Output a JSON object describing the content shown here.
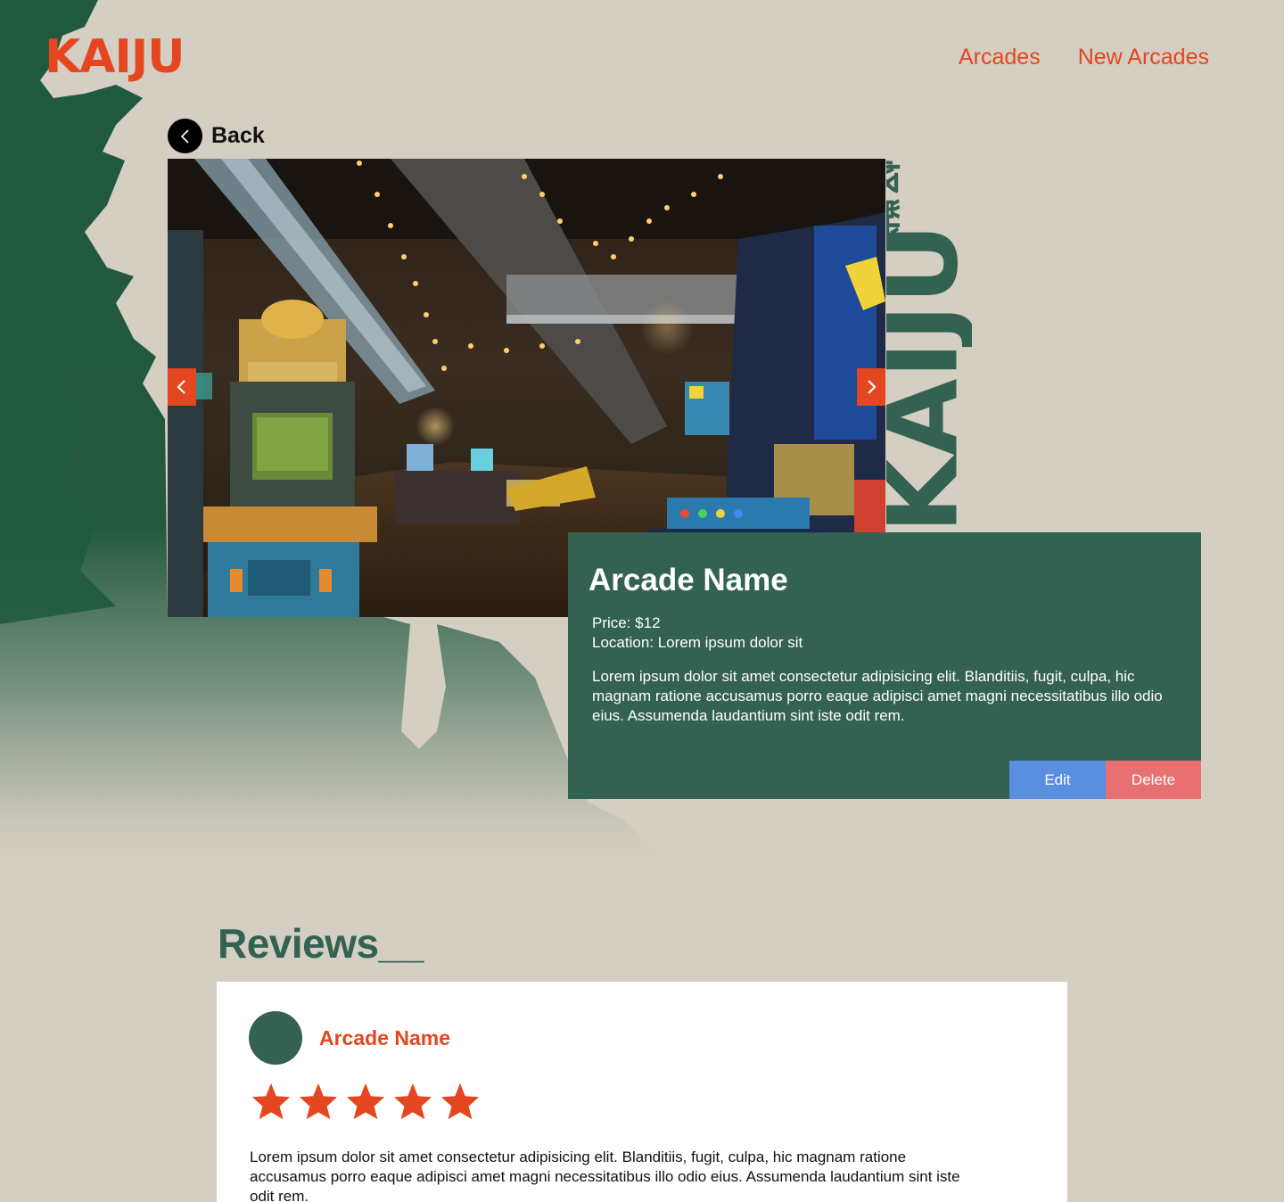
{
  "brand": {
    "logo": "KAIJU",
    "vertical_wordmark": "KAIJU",
    "vertical_kanji": "怪獣",
    "accent": "#e4461f",
    "green": "#336152",
    "background": "#d5cfc3"
  },
  "nav": {
    "links": [
      "Arcades",
      "New Arcades"
    ]
  },
  "back": {
    "label": "Back",
    "icon": "chevron-left-icon"
  },
  "carousel": {
    "prev_icon": "chevron-left-icon",
    "next_icon": "chevron-right-icon",
    "image": "arcade-interior-photo"
  },
  "arcade": {
    "name": "Arcade Name",
    "price": "Price: $12",
    "location": "Location: Lorem ipsum dolor sit",
    "description": "Lorem ipsum dolor sit amet consectetur adipisicing elit. Blanditiis, fugit, culpa, hic magnam ratione accusamus porro eaque adipisci amet magni necessitatibus illo odio eius. Assumenda laudantium sint iste odit rem.",
    "edit_label": "Edit",
    "delete_label": "Delete"
  },
  "reviews": {
    "title": "Reviews__",
    "items": [
      {
        "name": "Arcade Name",
        "rating": 5,
        "text": "Lorem ipsum dolor sit amet consectetur adipisicing elit. Blanditiis, fugit, culpa, hic magnam ratione accusamus porro eaque adipisci amet magni necessitatibus illo odio eius. Assumenda laudantium sint iste odit rem."
      }
    ]
  }
}
